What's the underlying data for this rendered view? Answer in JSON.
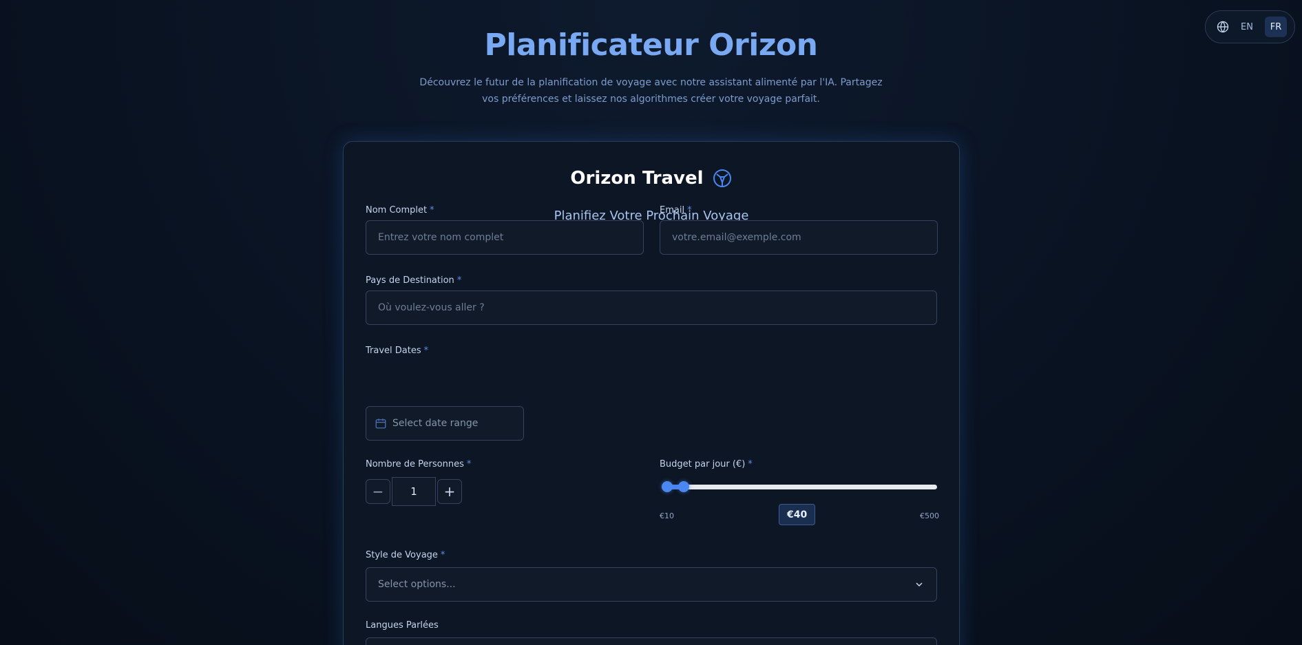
{
  "language_switcher": {
    "icon": "globe-icon",
    "options": [
      "EN",
      "FR"
    ],
    "active": "FR"
  },
  "header": {
    "title": "Planificateur Orizon",
    "subtitle": "Découvrez le futur de la planification de voyage avec notre assistant alimenté par l'IA. Partagez vos préférences et laissez nos algorithmes créer votre voyage parfait."
  },
  "card": {
    "brand_name": "Orizon Travel",
    "brand_icon": "globe-network-icon",
    "heading": "Planifiez Votre Prochain Voyage"
  },
  "form": {
    "full_name": {
      "label": "Nom Complet",
      "required": "*",
      "placeholder": "Entrez votre nom complet",
      "value": ""
    },
    "email": {
      "label": "Email",
      "required": "*",
      "placeholder": "votre.email@exemple.com",
      "value": ""
    },
    "destination": {
      "label": "Pays de Destination",
      "required": "*",
      "placeholder": "Où voulez-vous aller ?",
      "value": ""
    },
    "travel_dates": {
      "label": "Travel Dates",
      "required": "*",
      "placeholder": "Select date range",
      "icon": "calendar-icon"
    },
    "people": {
      "label": "Nombre de Personnes",
      "required": "*",
      "value": "1",
      "decrement": "−",
      "increment": "+"
    },
    "budget": {
      "label": "Budget par jour (€)",
      "required": "*",
      "min_label": "€10",
      "max_label": "€500",
      "value_label": "€40",
      "min": 10,
      "max": 500,
      "value": 40
    },
    "travel_style": {
      "label": "Style de Voyage",
      "required": "*",
      "placeholder": "Select options...",
      "icon": "chevron-down-icon"
    },
    "languages": {
      "label": "Langues Parlées"
    }
  },
  "colors": {
    "accent": "#4b87f0",
    "title": "#78a9f2",
    "background": "#0a1424",
    "card": "#0d1624"
  }
}
